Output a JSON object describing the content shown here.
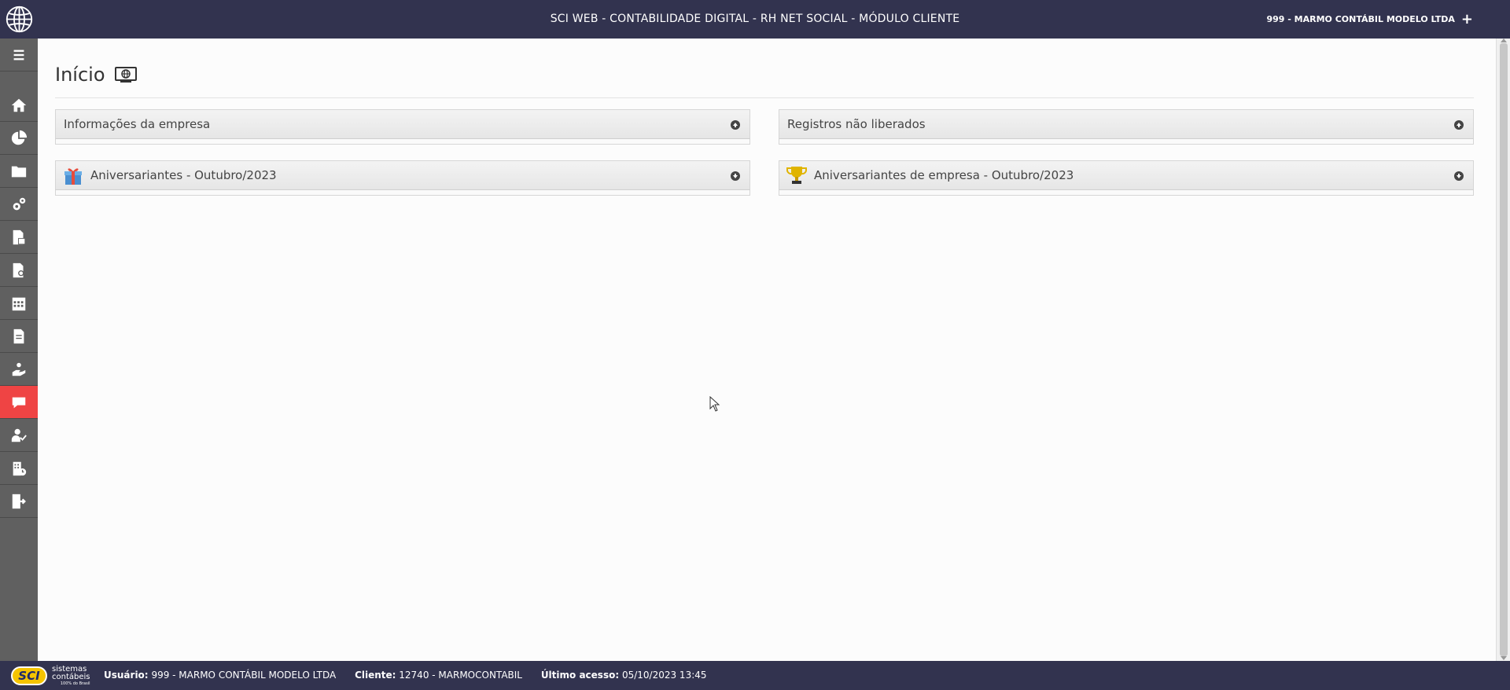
{
  "header": {
    "title": "SCI WEB - CONTABILIDADE DIGITAL - RH NET SOCIAL - MÓDULO CLIENTE",
    "company": "999 - MARMO CONTÁBIL MODELO LTDA",
    "plus_label": "+"
  },
  "sidebar": {
    "items": [
      {
        "icon": "menu-icon"
      },
      {
        "icon": "home-icon"
      },
      {
        "icon": "pie-chart-icon"
      },
      {
        "icon": "folder-icon"
      },
      {
        "icon": "gears-icon"
      },
      {
        "icon": "document-chart-icon"
      },
      {
        "icon": "document-search-icon"
      },
      {
        "icon": "calendar-icon"
      },
      {
        "icon": "document-icon"
      },
      {
        "icon": "hand-people-icon"
      },
      {
        "icon": "chat-icon",
        "active": true
      },
      {
        "icon": "user-check-icon"
      },
      {
        "icon": "building-clock-icon"
      },
      {
        "icon": "exit-icon"
      }
    ]
  },
  "main": {
    "page_title": "Início",
    "panels": [
      {
        "label": "Informações da empresa",
        "state": "collapsed",
        "icon": null
      },
      {
        "label": "Registros não liberados",
        "state": "collapsed",
        "icon": null
      },
      {
        "label": "Aniversariantes - Outubro/2023",
        "state": "expanded",
        "icon": "gift-icon"
      },
      {
        "label": "Aniversariantes de empresa - Outubro/2023",
        "state": "expanded",
        "icon": "trophy-icon"
      }
    ]
  },
  "footer": {
    "logo_text": "SCI",
    "brand_line1": "sistemas",
    "brand_line2": "contábeis",
    "brand_small": "100% do Brasil",
    "usuario_label": "Usuário:",
    "usuario_value": "999 - MARMO CONTÁBIL MODELO LTDA",
    "cliente_label": "Cliente:",
    "cliente_value": "12740 - MARMOCONTABIL",
    "ultimo_label": "Último acesso:",
    "ultimo_value": "05/10/2023 13:45"
  },
  "colors": {
    "header_bg": "#32334f",
    "sidebar_bg": "#606060",
    "active_item": "#ef4444",
    "panel_bg": "#ececec"
  }
}
